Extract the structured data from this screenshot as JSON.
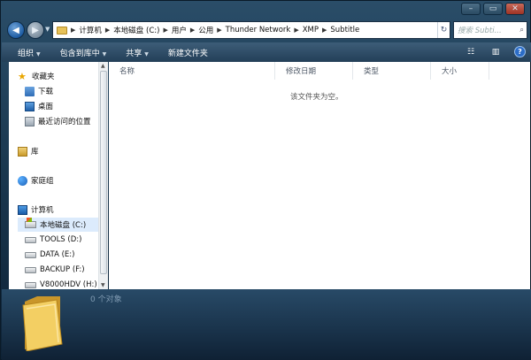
{
  "window": {
    "controls": {
      "minimize": "–",
      "maximize": "▭",
      "close": "✕"
    }
  },
  "address_bar": {
    "breadcrumbs": [
      "计算机",
      "本地磁盘 (C:)",
      "用户",
      "公用",
      "Thunder Network",
      "XMP",
      "Subtitle"
    ],
    "search_placeholder": "搜索 Subti..."
  },
  "toolbar": {
    "organize": "组织",
    "include_in_library": "包含到库中",
    "share": "共享",
    "new_folder": "新建文件夹"
  },
  "nav": {
    "favorites": "收藏夹",
    "downloads": "下载",
    "desktop": "桌面",
    "recent": "最近访问的位置",
    "libraries": "库",
    "homegroup": "家庭组",
    "computer": "计算机",
    "drives": [
      "本地磁盘 (C:)",
      "TOOLS (D:)",
      "DATA (E:)",
      "BACKUP (F:)",
      "V8000HDV (H:)"
    ]
  },
  "columns": {
    "name": "名称",
    "modified": "修改日期",
    "type": "类型",
    "size": "大小"
  },
  "content": {
    "empty_message": "该文件夹为空。"
  },
  "details": {
    "item_count": "0 个对象"
  },
  "colors": {
    "frame": "#1c3a52",
    "selection": "#dcebfc",
    "toolbar": "#2f4f6b"
  }
}
